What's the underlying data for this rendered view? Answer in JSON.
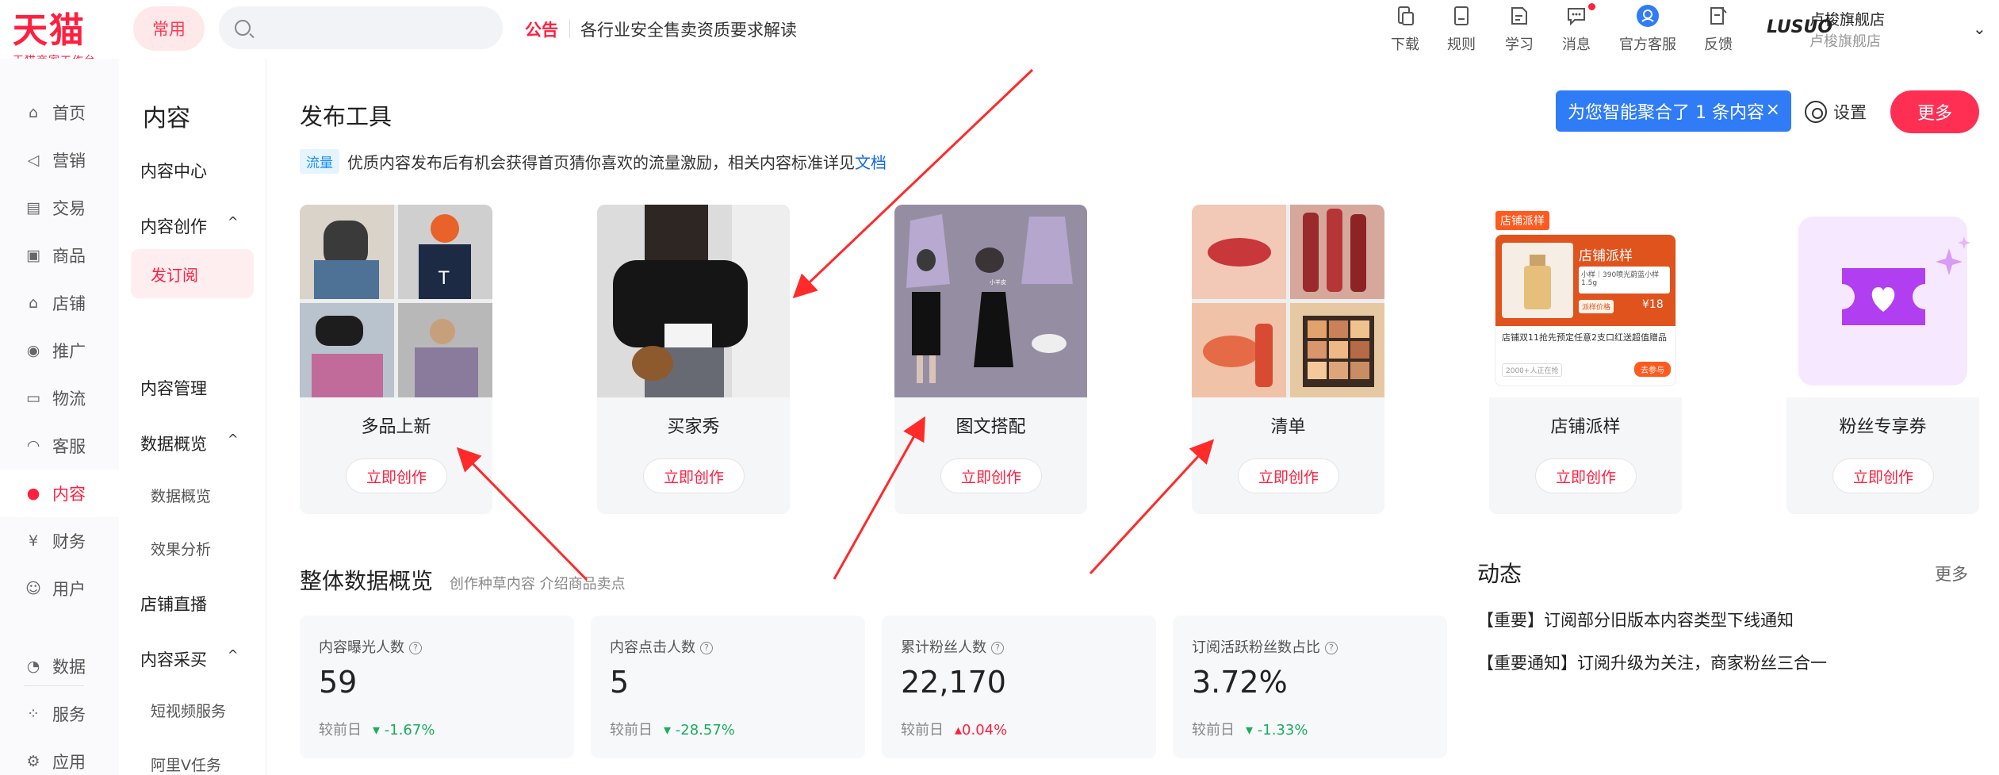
{
  "header": {
    "logo_main": "天猫",
    "logo_sub": "天猫商家工作台",
    "common_label": "常用",
    "search_placeholder": "",
    "notice_tag": "公告",
    "notice_text": "各行业安全售卖资质要求解读",
    "tools": [
      {
        "label": "下载",
        "icon": "download-icon"
      },
      {
        "label": "规则",
        "icon": "rules-icon"
      },
      {
        "label": "学习",
        "icon": "learn-icon"
      },
      {
        "label": "消息",
        "icon": "message-icon"
      },
      {
        "label": "官方客服",
        "icon": "service-icon"
      },
      {
        "label": "反馈",
        "icon": "feedback-icon"
      }
    ],
    "shop_logo": "LUSUO",
    "shop_name": "卢梭旗舰店",
    "shop_sub": "卢梭旗舰店"
  },
  "leftnav": {
    "items": [
      {
        "label": "首页",
        "icon": "home-icon"
      },
      {
        "label": "营销",
        "icon": "megaphone-icon"
      },
      {
        "label": "交易",
        "icon": "trade-icon"
      },
      {
        "label": "商品",
        "icon": "goods-icon"
      },
      {
        "label": "店铺",
        "icon": "store-icon"
      },
      {
        "label": "推广",
        "icon": "promote-icon"
      },
      {
        "label": "物流",
        "icon": "truck-icon"
      },
      {
        "label": "客服",
        "icon": "headset-icon"
      },
      {
        "label": "内容",
        "icon": "content-icon"
      },
      {
        "label": "财务",
        "icon": "finance-icon"
      },
      {
        "label": "用户",
        "icon": "user-icon"
      },
      {
        "label": "数据",
        "icon": "data-icon"
      },
      {
        "label": "服务",
        "icon": "service-grid-icon"
      },
      {
        "label": "应用",
        "icon": "apps-icon"
      }
    ]
  },
  "subnav": {
    "title": "内容",
    "items": {
      "center": "内容中心",
      "create": "内容创作",
      "subscribe": "发订阅",
      "manage": "内容管理",
      "overview": "数据概览",
      "overview_sub": "数据概览",
      "effect": "效果分析",
      "live": "店铺直播",
      "purchase": "内容采买",
      "video": "短视频服务",
      "aliv": "阿里V任务"
    }
  },
  "main": {
    "title": "发布工具",
    "flow_tag": "流量",
    "flow_text": "优质内容发布后有机会获得首页猜你喜欢的流量激励，相关内容标准详见",
    "flow_link": "文档",
    "aggregate": "为您智能聚合了 1 条内容",
    "settings": "设置",
    "more": "更多",
    "cards": [
      {
        "name": "多品上新",
        "button": "立即创作"
      },
      {
        "name": "买家秀",
        "button": "立即创作"
      },
      {
        "name": "图文搭配",
        "button": "立即创作"
      },
      {
        "name": "清单",
        "button": "立即创作"
      },
      {
        "name": "店铺派样",
        "button": "立即创作"
      },
      {
        "name": "粉丝专享券",
        "button": "立即创作"
      }
    ],
    "sample_card": {
      "badge": "店铺派样",
      "title": "店铺派样",
      "mini": "小样｜390喷光蔚蓝小样1.5g",
      "tag": "派样价格",
      "price": "¥18",
      "desc": "店铺双11抢先预定任意2支口红送超值赠品",
      "count": "2000+人正在抢",
      "btn": "去参与"
    },
    "overview_title": "整体数据概览",
    "overview_sub": "创作种草内容 介绍商品卖点",
    "stats": [
      {
        "label": "内容曝光人数",
        "value": "59",
        "compare": "较前日",
        "change": "-1.67%",
        "dir": "down"
      },
      {
        "label": "内容点击人数",
        "value": "5",
        "compare": "较前日",
        "change": "-28.57%",
        "dir": "down"
      },
      {
        "label": "累计粉丝人数",
        "value": "22,170",
        "compare": "较前日",
        "change": "0.04%",
        "dir": "up"
      },
      {
        "label": "订阅活跃粉丝数占比",
        "value": "3.72%",
        "compare": "较前日",
        "change": "-1.33%",
        "dir": "down"
      }
    ],
    "dynamics_title": "动态",
    "dynamics_more": "更多",
    "dynamics": [
      "【重要】订阅部分旧版本内容类型下线通知",
      "【重要通知】订阅升级为关注，商家粉丝三合一"
    ]
  },
  "colors": {
    "brand": "#ff1f3f",
    "blue": "#2f7cf6",
    "green": "#1aad5e",
    "arrow": "#ff2a2a"
  }
}
